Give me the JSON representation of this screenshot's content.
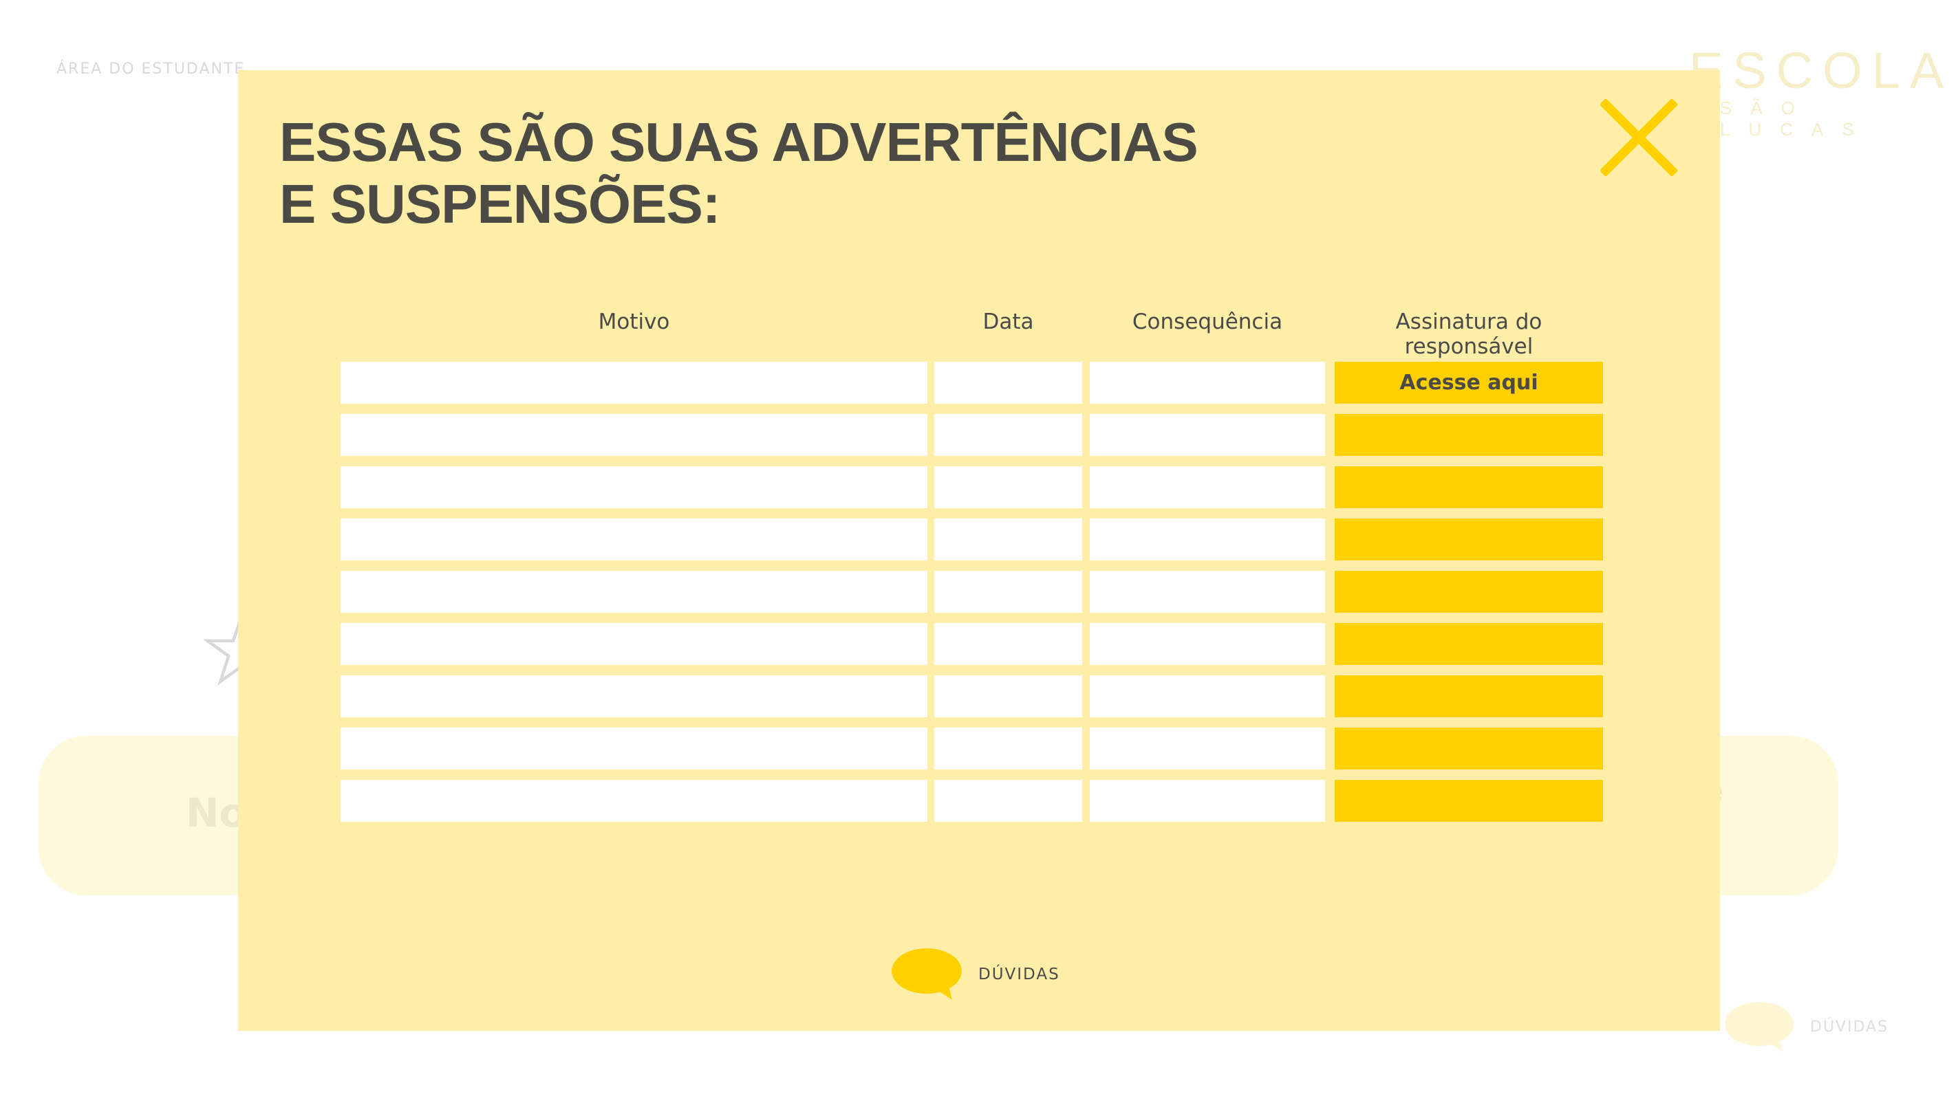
{
  "background": {
    "area_label": "ÁREA DO ESTUDANTE",
    "logo_title": "ESCOLA",
    "logo_subtitle": "SÃO LUCAS",
    "banner_left_text": "No",
    "banner_right_line1": "e",
    "banner_right_line2": "s",
    "help_label": "DÚVIDAS",
    "star_icon": "star-outline-icon",
    "chat_icon": "chat-bubble-icon"
  },
  "modal": {
    "title_line1": "ESSAS SÃO SUAS ADVERTÊNCIAS",
    "title_line2": "E SUSPENSÕES:",
    "close_icon": "close-x-icon",
    "table": {
      "headers": {
        "motivo": "Motivo",
        "data": "Data",
        "consequencia": "Consequência",
        "assinatura": "Assinatura do responsável"
      },
      "rows": [
        {
          "motivo": "",
          "data": "",
          "consequencia": "",
          "assinatura": "Acesse aqui"
        },
        {
          "motivo": "",
          "data": "",
          "consequencia": "",
          "assinatura": ""
        },
        {
          "motivo": "",
          "data": "",
          "consequencia": "",
          "assinatura": ""
        },
        {
          "motivo": "",
          "data": "",
          "consequencia": "",
          "assinatura": ""
        },
        {
          "motivo": "",
          "data": "",
          "consequencia": "",
          "assinatura": ""
        },
        {
          "motivo": "",
          "data": "",
          "consequencia": "",
          "assinatura": ""
        },
        {
          "motivo": "",
          "data": "",
          "consequencia": "",
          "assinatura": ""
        },
        {
          "motivo": "",
          "data": "",
          "consequencia": "",
          "assinatura": ""
        },
        {
          "motivo": "",
          "data": "",
          "consequencia": "",
          "assinatura": ""
        }
      ]
    },
    "help_label": "DÚVIDAS",
    "help_icon": "chat-bubble-icon"
  },
  "colors": {
    "modal_bg": "#ffeea8",
    "accent_yellow": "#ffd000",
    "text_dark": "#4b4a44",
    "cell_white": "#ffffff"
  }
}
